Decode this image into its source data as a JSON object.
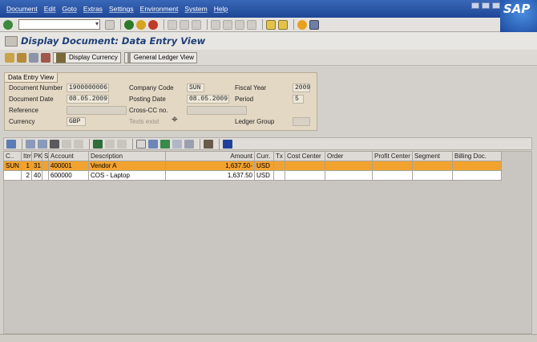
{
  "menu": {
    "items": [
      "Document",
      "Edit",
      "Goto",
      "Extras",
      "Settings",
      "Environment",
      "System",
      "Help"
    ]
  },
  "brand": {
    "logo_text": "SAP",
    "accent": "#2a58ad"
  },
  "command_field": {
    "value": ""
  },
  "title": "Display Document: Data Entry View",
  "app_toolbar": {
    "display_currency": "Display Currency",
    "general_ledger_view": "General Ledger View"
  },
  "panel": {
    "tab_label": "Data Entry View",
    "document_number_label": "Document Number",
    "document_number": "1900000006",
    "company_code_label": "Company Code",
    "company_code": "SUN",
    "fiscal_year_label": "Fiscal Year",
    "fiscal_year": "2009",
    "document_date_label": "Document Date",
    "document_date": "08.05.2009",
    "posting_date_label": "Posting Date",
    "posting_date": "08.05.2009",
    "period_label": "Period",
    "period": "5",
    "reference_label": "Reference",
    "reference": "",
    "cross_cc_label": "Cross-CC no.",
    "cross_cc": "",
    "currency_label": "Currency",
    "currency": "GBP",
    "texts_exist_label": "Texts exist",
    "ledger_group_label": "Ledger Group",
    "ledger_group": ""
  },
  "grid": {
    "columns": [
      "C..",
      "Itm",
      "PK",
      "S",
      "Account",
      "Description",
      "Amount",
      "Curr.",
      "Tx",
      "Cost Center",
      "Order",
      "Profit Center",
      "Segment",
      "Billing Doc."
    ],
    "rows": [
      {
        "c": "SUN",
        "itm": "1",
        "pk": "31",
        "s": "",
        "account": "400001",
        "description": "Vendor A",
        "amount": "1,637.50-",
        "curr": "USD",
        "tx": "",
        "cost_center": "",
        "order": "",
        "profit_center": "",
        "segment": "",
        "billing_doc": "",
        "selected": true
      },
      {
        "c": "",
        "itm": "2",
        "pk": "40",
        "s": "",
        "account": "600000",
        "description": "COS - Laptop",
        "amount": "1,637.50",
        "curr": "USD",
        "tx": "",
        "cost_center": "",
        "order": "",
        "profit_center": "",
        "segment": "",
        "billing_doc": "",
        "selected": false
      }
    ]
  }
}
